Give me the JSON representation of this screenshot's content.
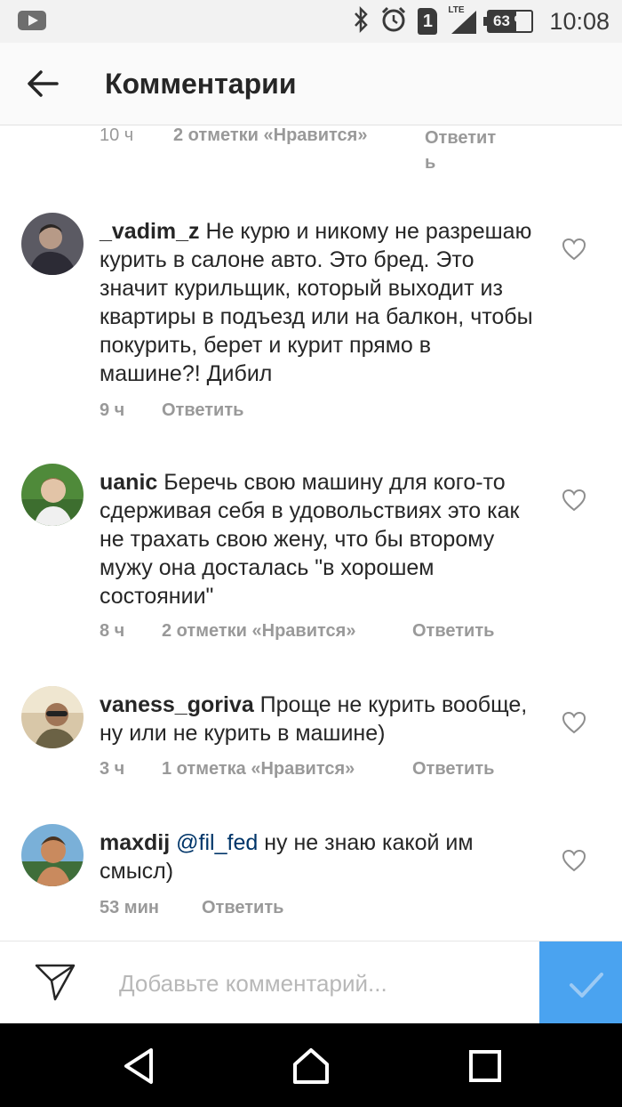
{
  "status_bar": {
    "left_icon": "youtube-icon",
    "icons": [
      "bluetooth-icon",
      "alarm-icon",
      "sim-icon",
      "signal-icon",
      "battery-icon"
    ],
    "sim_number": "1",
    "network": "LTE",
    "battery": "63 %",
    "battery_level": 0.63,
    "time": "10:08"
  },
  "header": {
    "title": "Комментарии",
    "back_icon": "arrow-left-icon"
  },
  "top_meta": {
    "time": "10 ч",
    "likes": "2 отметки «Нравится»",
    "reply": "Ответит",
    "reply_wrap": "ь"
  },
  "comments": [
    {
      "username": "_vadim_z",
      "text": " Не курю и никому не разрешаю курить в салоне авто. Это бред. Это значит курильщик, который выходит из квартиры в подъезд или на балкон, чтобы покурить, берет и курит прямо в машине?! Дибил",
      "time": "9 ч",
      "likes": "",
      "reply": "Ответить"
    },
    {
      "username": "uanic",
      "text": " Беречь свою машину для кого-то сдерживая себя в удовольствиях это как не трахать свою жену, что бы второму мужу она досталась \"в хорошем состоянии\"",
      "time": "8 ч",
      "likes": "2 отметки «Нравится»",
      "reply": "Ответить"
    },
    {
      "username": "vaness_goriva",
      "text": " Проще не курить вообще, ну или не курить в машине)",
      "time": "3 ч",
      "likes": "1 отметка «Нравится»",
      "reply": "Ответить"
    },
    {
      "username": "maxdij",
      "mention": "@fil_fed",
      "text": " ну не знаю какой им смысл)",
      "time": "53 мин",
      "likes": "",
      "reply": "Ответить"
    }
  ],
  "composer": {
    "placeholder": "Добавьте комментарий...",
    "value": ""
  },
  "colors": {
    "accent": "#4aa3f0",
    "text": "#262626",
    "meta": "#999999",
    "mention": "#003569"
  }
}
